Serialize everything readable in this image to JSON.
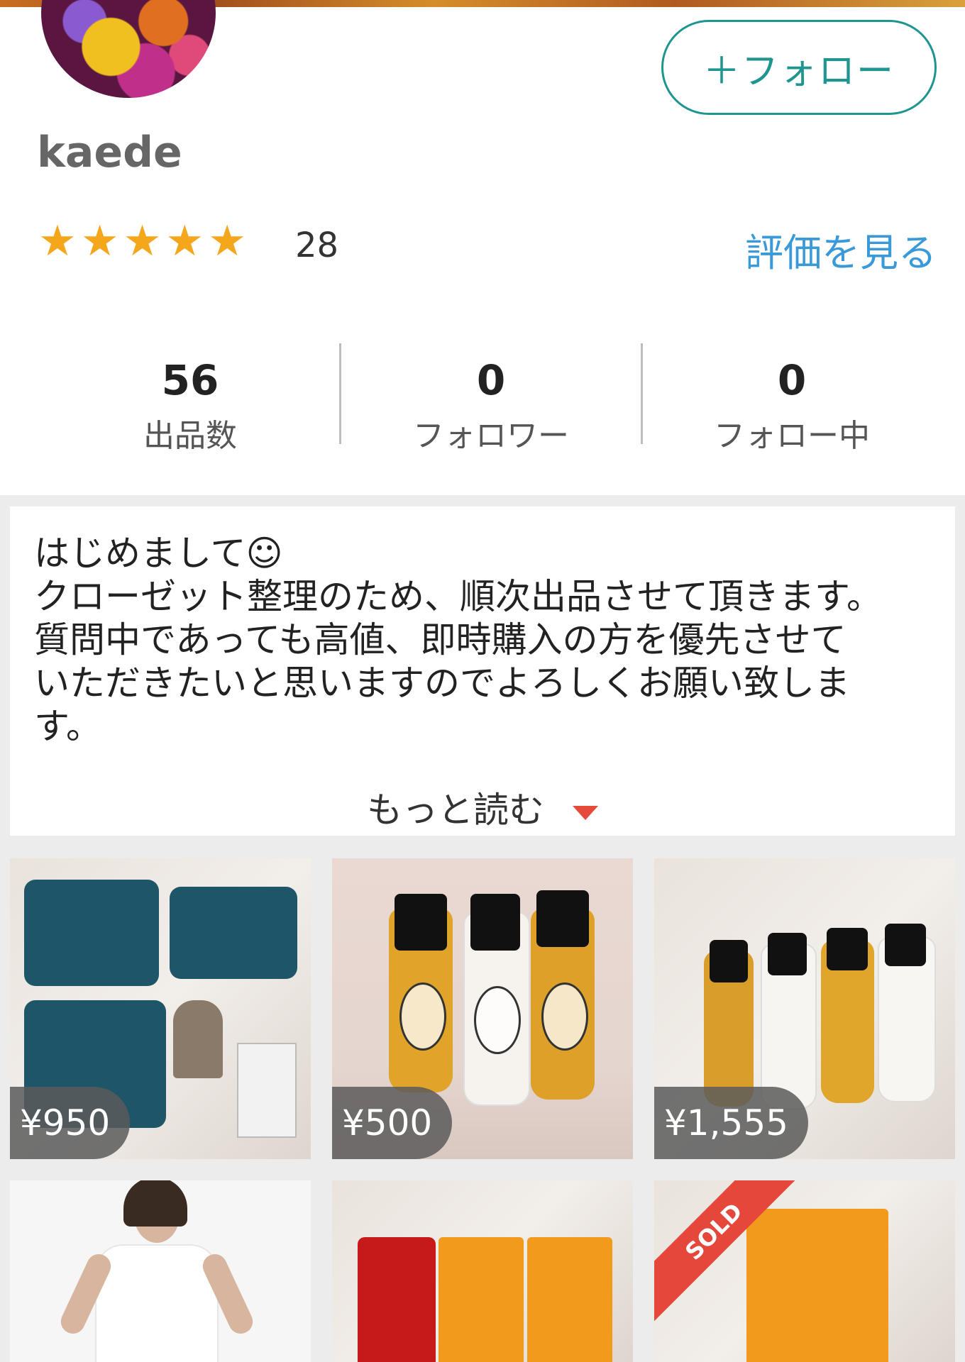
{
  "profile": {
    "username": "kaede",
    "follow_label": "＋フォロー",
    "rating": 5,
    "rating_count": "28",
    "view_reviews_label": "評価を見る",
    "stats": [
      {
        "value": "56",
        "label": "出品数"
      },
      {
        "value": "0",
        "label": "フォロワー"
      },
      {
        "value": "0",
        "label": "フォロー中"
      }
    ],
    "star_color": "#f5a71c",
    "accent_color": "#1f9590",
    "link_color": "#3a9ad9"
  },
  "bio": {
    "text": "はじめまして☺\nクローゼット整理のため、順次出品させて頂きます。\n質問中であっても高値、即時購入の方を優先させて\nいただきたいと思いますのでよろしくお願い致しま\nす。",
    "read_more_label": "もっと読む"
  },
  "items": [
    {
      "price": "¥950",
      "image": "blue-pouches-set",
      "sold": false
    },
    {
      "price": "¥500",
      "image": "three-bottles",
      "sold": false
    },
    {
      "price": "¥1,555",
      "image": "four-bottles",
      "sold": false
    },
    {
      "price": "",
      "image": "white-dress-model",
      "sold": false
    },
    {
      "price": "",
      "image": "hair-oil-set-red-tube",
      "sold": false
    },
    {
      "price": "",
      "image": "hair-oil-box",
      "sold": true,
      "sold_label": "SOLD"
    }
  ]
}
